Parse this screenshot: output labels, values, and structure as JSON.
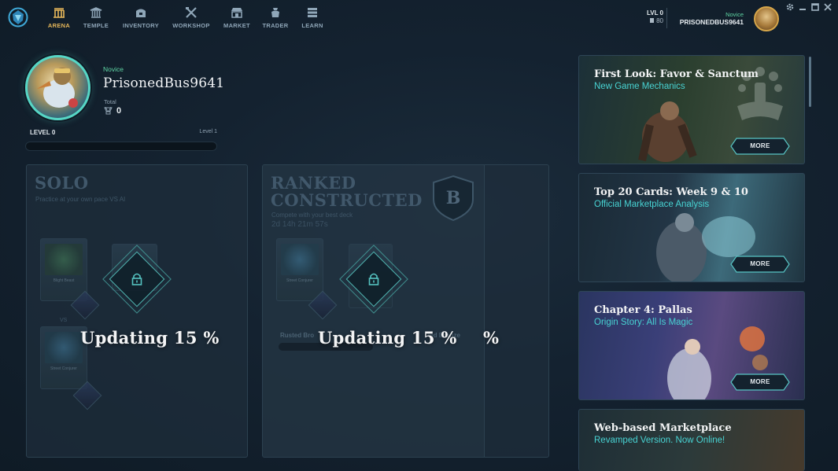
{
  "nav": {
    "items": [
      {
        "id": "arena",
        "label": "ARENA",
        "icon": "arena-icon",
        "active": true
      },
      {
        "id": "temple",
        "label": "TEMPLE",
        "icon": "temple-icon"
      },
      {
        "id": "inventory",
        "label": "INVENTORY",
        "icon": "inventory-icon"
      },
      {
        "id": "workshop",
        "label": "WORKSHOP",
        "icon": "workshop-icon"
      },
      {
        "id": "market",
        "label": "MARKET",
        "icon": "market-icon"
      },
      {
        "id": "trader",
        "label": "TRADER",
        "icon": "trader-icon"
      },
      {
        "id": "learn",
        "label": "LEARN",
        "icon": "learn-icon"
      }
    ],
    "level_label": "LVL 0",
    "coins": "80",
    "rank": "Novice",
    "username": "PRISONEDBUS9641"
  },
  "profile": {
    "rank": "Novice",
    "name": "PrisonedBus9641",
    "total_label": "Total",
    "total_value": "0",
    "level_label": "LEVEL 0",
    "next_level_label": "Level 1",
    "level_progress": 0
  },
  "solo": {
    "title": "SOLO",
    "subtitle": "Practice at your own pace VS AI",
    "card1_name": "Blight Beast",
    "card2_name": "Street Conjurer",
    "vs": "VS",
    "updating": "Updating 15 %"
  },
  "ranked": {
    "title_line1": "RANKED",
    "title_line2": "CONSTRUCTED",
    "subtitle": "Compete with your best deck",
    "timer": "2d 14h 21m 57s",
    "badge": "B",
    "card_name": "Street Conjurer",
    "deck_left": "Rusted Bro",
    "deck_right": "ied Bronze",
    "updating": "Updating 15 %",
    "updating_tail": "%"
  },
  "news": [
    {
      "title": "First Look: Favor & Sanctum",
      "subtitle": "New Game Mechanics",
      "more": "MORE"
    },
    {
      "title": "Top 20 Cards: Week 9 & 10",
      "subtitle": "Official Marketplace Analysis",
      "more": "MORE"
    },
    {
      "title": "Chapter 4: Pallas",
      "subtitle": "Origin Story: All Is Magic",
      "more": "MORE"
    },
    {
      "title": "Web-based Marketplace",
      "subtitle": "Revamped Version. Now Online!"
    }
  ],
  "colors": {
    "accent": "#48d3d3",
    "gold": "#e7b85a",
    "green": "#5fd6a4"
  }
}
